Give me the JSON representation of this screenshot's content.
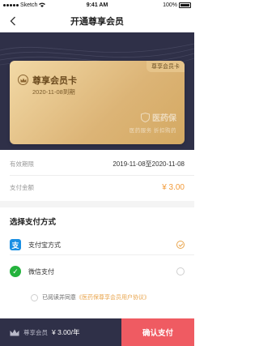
{
  "status_bar": {
    "carrier": "Sketch",
    "time": "9:41 AM",
    "battery": "100%"
  },
  "nav": {
    "title": "开通尊享会员",
    "back_icon": "chevron-left-icon"
  },
  "card": {
    "tag": "尊享会员卡",
    "title": "尊享会员卡",
    "expiry": "2020-11-08到期",
    "brand": "医药保",
    "slogan": "医药服务  折扣购药",
    "colors": {
      "gold_light": "#f2d9a6",
      "gold_dark": "#d4a962"
    }
  },
  "info": {
    "validity_label": "有效期限",
    "validity_value": "2019-11-08至2020-11-08",
    "amount_label": "支付金额",
    "amount_value": "¥ 3.00"
  },
  "payment": {
    "section_title": "选择支付方式",
    "options": [
      {
        "label": "支付宝方式",
        "icon": "alipay-icon",
        "glyph": "支",
        "selected": true
      },
      {
        "label": "微信支付",
        "icon": "wechat-icon",
        "glyph": "✓",
        "selected": false
      }
    ]
  },
  "agreement": {
    "prefix": "已阅读并同意",
    "link": "《医药保尊享会员用户协议》"
  },
  "bottom": {
    "label": "尊享会员",
    "price": "¥ 3.00/年",
    "button": "确认支付"
  },
  "colors": {
    "dark_navy": "#2f3048",
    "accent_orange": "#f29b3a",
    "confirm_red": "#ef5b62"
  }
}
